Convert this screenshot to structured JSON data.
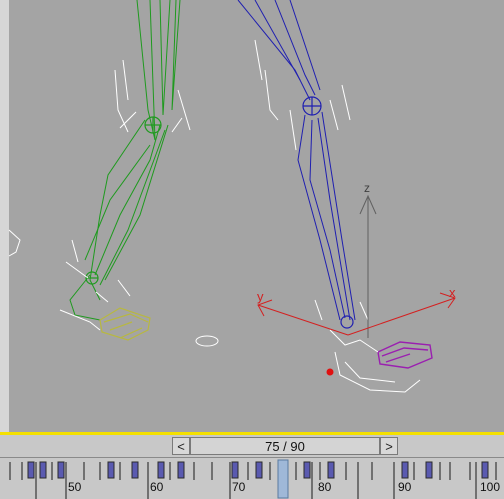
{
  "viewport": {
    "axis_labels": {
      "x": "x",
      "y": "y",
      "z": "z"
    },
    "colors": {
      "background": "#a4a4a4",
      "left_leg": "#1f9a1f",
      "right_leg": "#1f1fb0",
      "foot_left": "#b8b840",
      "foot_right": "#9a1fb0",
      "helpers": "#ffffff",
      "axis_red": "#d42020",
      "axis_gray": "#606060"
    }
  },
  "time_slider": {
    "prev_label": "<",
    "next_label": ">",
    "frame_readout": "75 / 90",
    "current_frame": 75,
    "total_frames": 90
  },
  "trackbar": {
    "tick_labels": [
      "50",
      "60",
      "70",
      "80",
      "90",
      "100"
    ],
    "highlight_color": "#f4e000"
  }
}
